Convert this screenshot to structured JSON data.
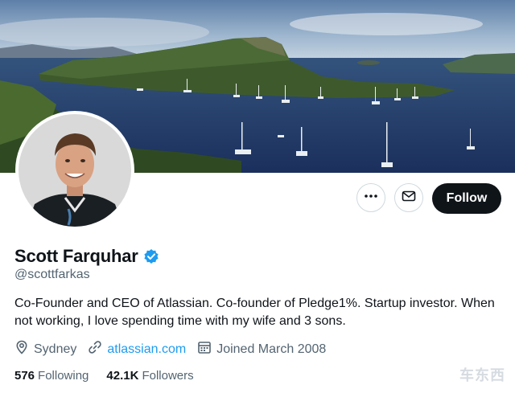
{
  "profile": {
    "name": "Scott Farquhar",
    "handle": "@scottfarkas",
    "bio": "Co-Founder and CEO of Atlassian. Co-founder of Pledge1%. Startup investor. When not working, I love spending time with my wife and 3 sons.",
    "location": "Sydney",
    "website": "atlassian.com",
    "joined": "Joined March 2008",
    "following_count": "576",
    "following_label": "Following",
    "followers_count": "42.1K",
    "followers_label": "Followers"
  },
  "actions": {
    "follow_label": "Follow"
  },
  "icons": {
    "more": "more-icon",
    "message": "mail-icon",
    "verified": "verified-badge-icon",
    "location": "location-pin-icon",
    "link": "link-icon",
    "calendar": "calendar-icon"
  },
  "colors": {
    "accent": "#1d9bf0",
    "follow_bg": "#0f1419",
    "muted_text": "#536471"
  },
  "watermark": "车东西"
}
